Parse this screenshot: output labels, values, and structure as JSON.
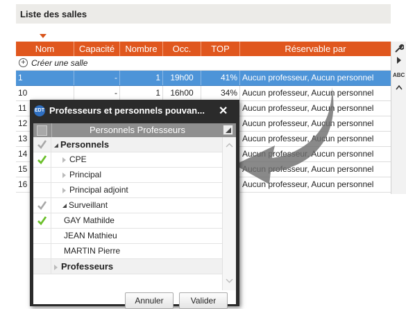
{
  "panel": {
    "title": "Liste des salles"
  },
  "columns": [
    "Nom",
    "Capacité",
    "Nombre",
    "Occ.",
    "TOP",
    "Réservable par"
  ],
  "create_label": "Créer une salle",
  "rows": [
    {
      "nom": "1",
      "capacite": "-",
      "nombre": "1",
      "occ": "19h00",
      "top": "41%",
      "reservable": "Aucun professeur, Aucun personnel"
    },
    {
      "nom": "10",
      "capacite": "-",
      "nombre": "1",
      "occ": "16h00",
      "top": "34%",
      "reservable": "Aucun professeur, Aucun personnel"
    },
    {
      "nom": "11",
      "reservable": "Aucun professeur, Aucun personnel"
    },
    {
      "nom": "12",
      "reservable": "Aucun professeur, Aucun personnel"
    },
    {
      "nom": "13",
      "reservable": "Aucun professeur, Aucun personnel"
    },
    {
      "nom": "14",
      "reservable": "Aucun professeur, Aucun personnel"
    },
    {
      "nom": "15",
      "reservable": "Aucun professeur, Aucun personnel"
    },
    {
      "nom": "16",
      "reservable": "Aucun professeur, Aucun personnel"
    }
  ],
  "right_bar": {
    "abc_label": "ABC"
  },
  "dialog": {
    "logo_text": "EDT",
    "title": "Professeurs et personnels pouvan...",
    "close": "✕",
    "header": "Personnels Professeurs",
    "items": [
      {
        "label": "Personnels",
        "type": "group-open",
        "check": "gray"
      },
      {
        "label": "CPE",
        "type": "child-closed",
        "check": "green"
      },
      {
        "label": "Principal",
        "type": "child-closed",
        "check": "none"
      },
      {
        "label": "Principal adjoint",
        "type": "child-closed",
        "check": "none"
      },
      {
        "label": "Surveillant",
        "type": "child-open",
        "check": "gray"
      },
      {
        "label": "GAY Mathilde",
        "type": "leaf",
        "check": "green"
      },
      {
        "label": "JEAN Mathieu",
        "type": "leaf",
        "check": "none"
      },
      {
        "label": "MARTIN Pierre",
        "type": "leaf",
        "check": "none"
      },
      {
        "label": "Professeurs",
        "type": "group-closed",
        "check": "none"
      }
    ],
    "cancel_label": "Annuler",
    "ok_label": "Valider"
  },
  "colors": {
    "header": "#e0571e",
    "selected": "#4d94d8",
    "check_green": "#6abf2a",
    "dialog": "#2b2b2b"
  }
}
